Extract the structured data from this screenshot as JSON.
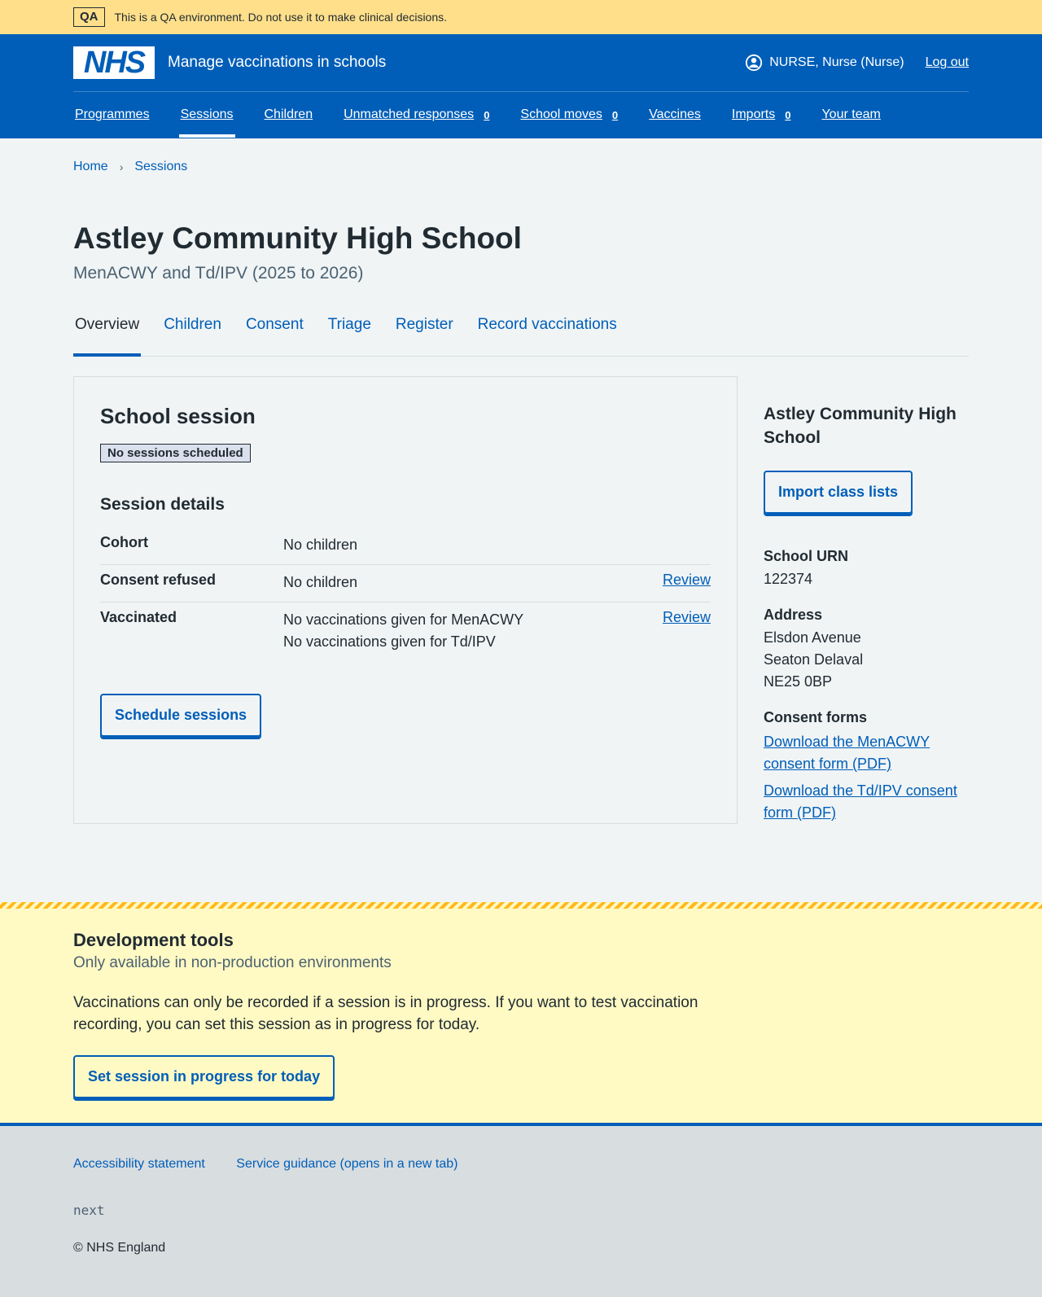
{
  "qa_banner": {
    "tag": "QA",
    "message": "This is a QA environment. Do not use it to make clinical decisions."
  },
  "header": {
    "logo_text": "NHS",
    "service_name": "Manage vaccinations in schools",
    "user": "NURSE, Nurse (Nurse)",
    "logout": "Log out"
  },
  "nav": [
    {
      "label": "Programmes"
    },
    {
      "label": "Sessions"
    },
    {
      "label": "Children"
    },
    {
      "label": "Unmatched responses",
      "count": "0"
    },
    {
      "label": "School moves",
      "count": "0"
    },
    {
      "label": "Vaccines"
    },
    {
      "label": "Imports",
      "count": "0"
    },
    {
      "label": "Your team"
    }
  ],
  "breadcrumb": [
    "Home",
    "Sessions"
  ],
  "page": {
    "title": "Astley Community High School",
    "caption": "MenACWY and Td/IPV (2025 to 2026)"
  },
  "tabs": [
    "Overview",
    "Children",
    "Consent",
    "Triage",
    "Register",
    "Record vaccinations"
  ],
  "card": {
    "title": "School session",
    "status": "No sessions scheduled",
    "details_heading": "Session details",
    "rows": [
      {
        "key": "Cohort",
        "value": "No children",
        "action": ""
      },
      {
        "key": "Consent refused",
        "value": "No children",
        "action": "Review"
      },
      {
        "key": "Vaccinated",
        "value": "No vaccinations given for MenACWY",
        "value2": "No vaccinations given for Td/IPV",
        "action": "Review"
      }
    ],
    "button": "Schedule sessions"
  },
  "sidebar": {
    "title": "Astley Community High School",
    "button": "Import class lists",
    "urn_label": "School URN",
    "urn": "122374",
    "address_label": "Address",
    "address": [
      "Elsdon Avenue",
      "Seaton Delaval",
      "NE25 0BP"
    ],
    "consent_label": "Consent forms",
    "links": [
      "Download the MenACWY consent form (PDF)",
      "Download the Td/IPV consent form (PDF)"
    ]
  },
  "dev": {
    "title": "Development tools",
    "subtitle": "Only available in non-production environments",
    "text": "Vaccinations can only be recorded if a session is in progress. If you want to test vaccination recording, you can set this session as in progress for today.",
    "button": "Set session in progress for today"
  },
  "footer": {
    "links": [
      "Accessibility statement",
      "Service guidance (opens in a new tab)"
    ],
    "build": "next",
    "copyright": "© NHS England"
  },
  "colors": {
    "nhs_blue": "#005eb8",
    "qa_yellow": "#ffdf8a",
    "dev_yellow": "#fff9c4"
  }
}
